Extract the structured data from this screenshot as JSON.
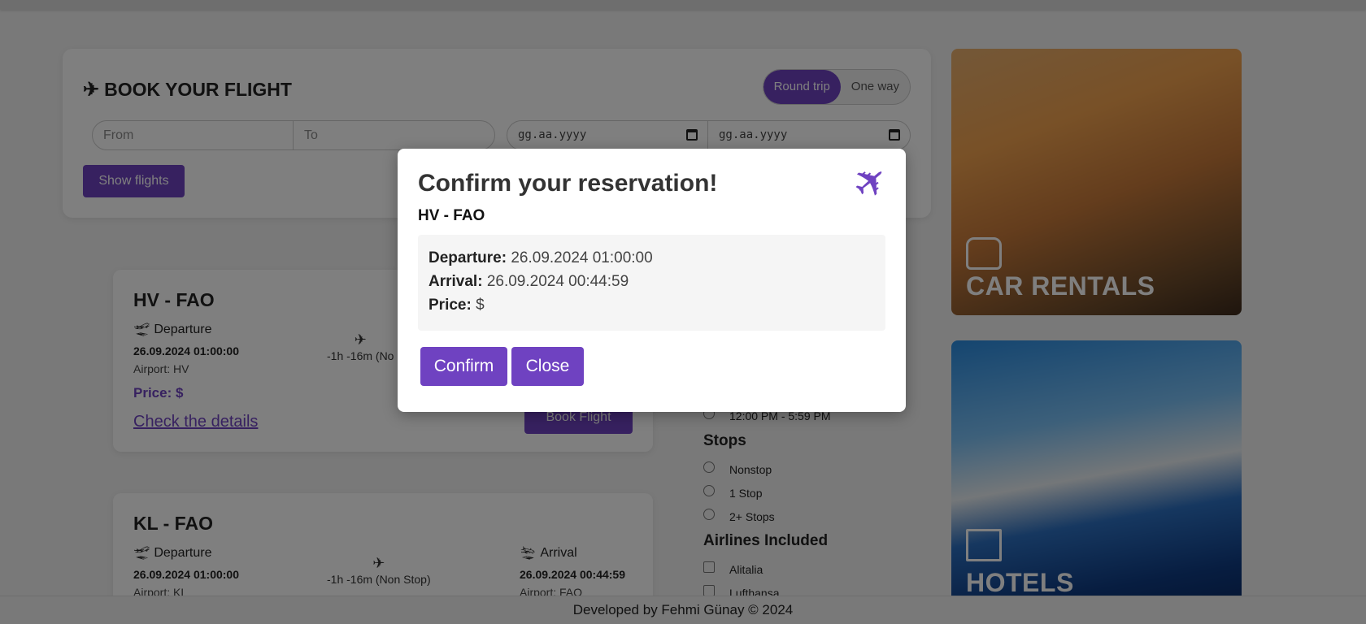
{
  "booking": {
    "title": "BOOK YOUR FLIGHT",
    "plane_glyph": "✈",
    "trip_types": [
      "Round trip",
      "One way"
    ],
    "selected_trip": "Round trip",
    "from_placeholder": "From",
    "to_placeholder": "To",
    "date_placeholder_1": "gg.aa.yyyy",
    "date_placeholder_2": "gg.aa.yyyy",
    "show_button": "Show flights"
  },
  "flights": [
    {
      "route": "HV - FAO",
      "departure_label": "Departure",
      "departure_time": "26.09.2024 01:00:00",
      "departure_airport": "Airport: HV",
      "duration": "-1h -16m (No",
      "price": "Price: $",
      "details_link": "Check the details",
      "book_button": "Book Flight"
    },
    {
      "route": "KL - FAO",
      "departure_label": "Departure",
      "departure_time": "26.09.2024 01:00:00",
      "departure_airport": "Airport: KL",
      "duration": "-1h -16m (Non Stop)",
      "arrival_label": "Arrival",
      "arrival_time": "26.09.2024 00:44:59",
      "arrival_airport": "Airport: FAO"
    }
  ],
  "filters": {
    "time_option": "12:00 PM - 5:59 PM",
    "stops_title": "Stops",
    "stops": [
      "Nonstop",
      "1 Stop",
      "2+ Stops"
    ],
    "airlines_title": "Airlines Included",
    "airlines": [
      "Alitalia",
      "Lufthansa"
    ]
  },
  "promos": {
    "car": "CAR RENTALS",
    "hotel": "HOTELS"
  },
  "footer": "Developed by Fehmi Günay © 2024",
  "modal": {
    "title": "Confirm your reservation!",
    "plane_glyph": "✈",
    "route": "HV - FAO",
    "departure_label": "Departure:",
    "departure_value": "26.09.2024 01:00:00",
    "arrival_label": "Arrival:",
    "arrival_value": "26.09.2024 00:44:59",
    "price_label": "Price:",
    "price_value": "$",
    "confirm_button": "Confirm",
    "close_button": "Close"
  },
  "colors": {
    "accent": "#6f42c1",
    "overlay": "rgba(0,0,0,0.5)"
  }
}
